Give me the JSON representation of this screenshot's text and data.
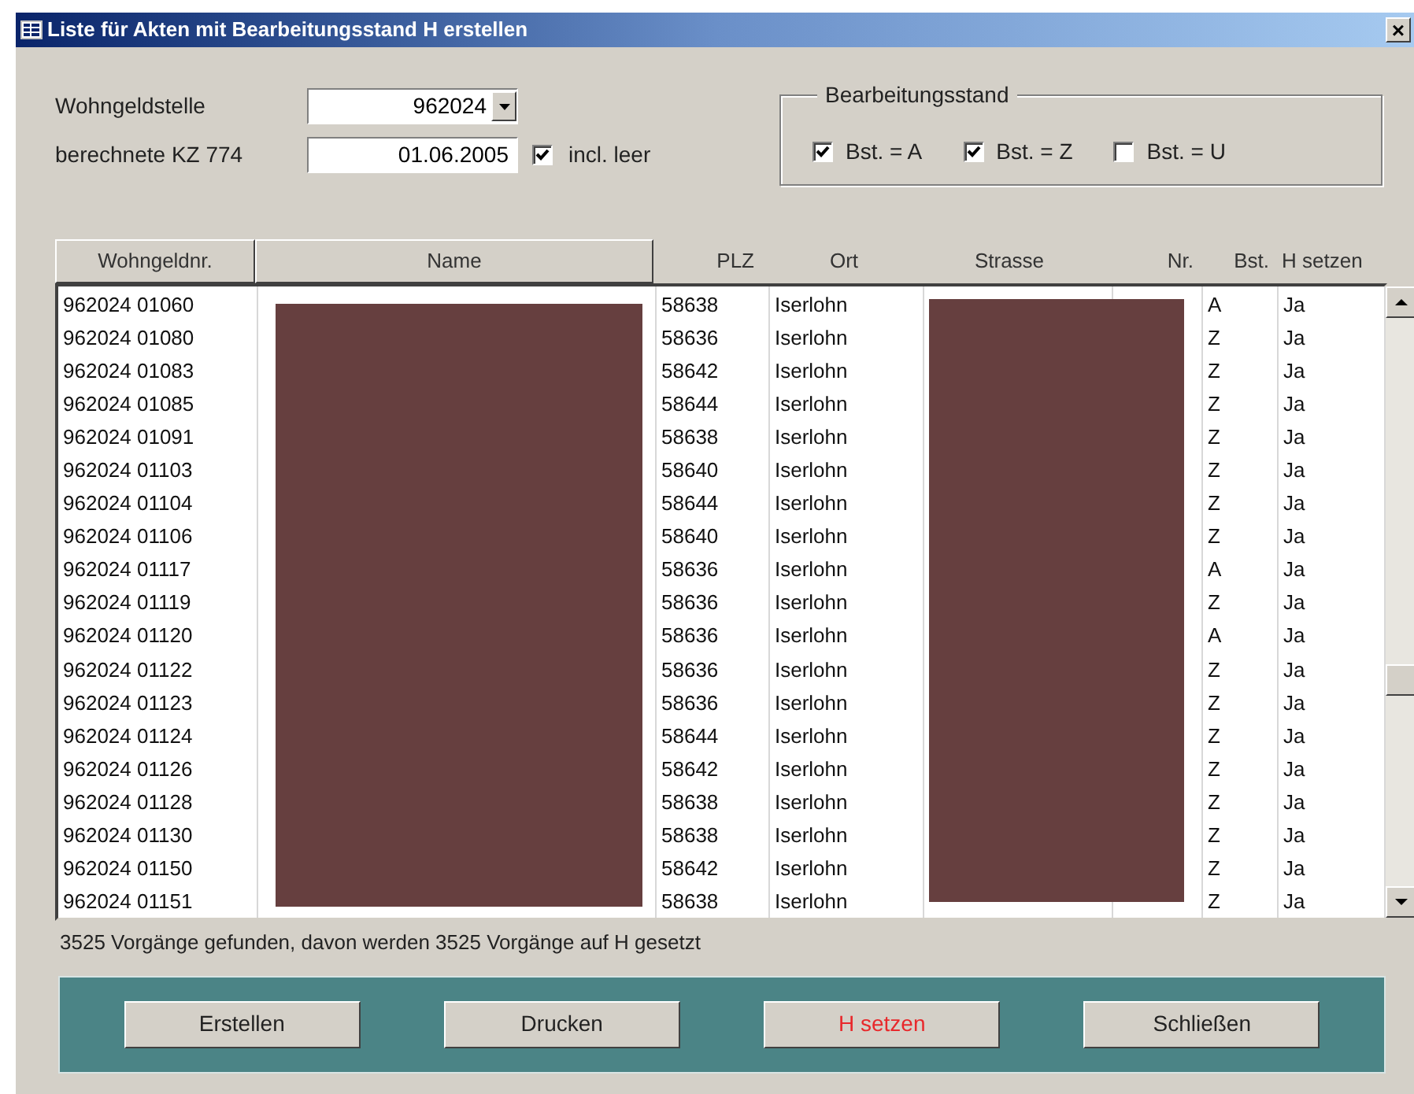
{
  "window": {
    "title": "Liste für Akten mit Bearbeitungsstand H erstellen",
    "close": "×"
  },
  "fields": [
    {
      "label": "Wohngeldstelle",
      "value": "962024",
      "kind": "combo"
    },
    {
      "label": "berechnete KZ 774",
      "value": "01.06.2005",
      "kind": "text",
      "checkbox": {
        "label": "incl. leer",
        "checked": true
      }
    }
  ],
  "bearbeitungsstand": {
    "title": "Bearbeitungsstand",
    "options": [
      {
        "label": "Bst. = A",
        "checked": true
      },
      {
        "label": "Bst. = Z",
        "checked": true
      },
      {
        "label": "Bst. = U",
        "checked": false
      }
    ]
  },
  "table": {
    "columns": [
      "Wohngeldnr.",
      "Name",
      "PLZ",
      "Ort",
      "Strasse",
      "Nr.",
      "Bst.",
      "H setzen"
    ],
    "rows": [
      {
        "wohngeldnr": "962024 01060",
        "plz": "58638",
        "ort": "Iserlohn",
        "bst": "A",
        "h_setzen": "Ja"
      },
      {
        "wohngeldnr": "962024 01080",
        "plz": "58636",
        "ort": "Iserlohn",
        "bst": "Z",
        "h_setzen": "Ja"
      },
      {
        "wohngeldnr": "962024 01083",
        "plz": "58642",
        "ort": "Iserlohn",
        "bst": "Z",
        "h_setzen": "Ja"
      },
      {
        "wohngeldnr": "962024 01085",
        "plz": "58644",
        "ort": "Iserlohn",
        "bst": "Z",
        "h_setzen": "Ja"
      },
      {
        "wohngeldnr": "962024 01091",
        "plz": "58638",
        "ort": "Iserlohn",
        "bst": "Z",
        "h_setzen": "Ja"
      },
      {
        "wohngeldnr": "962024 01103",
        "plz": "58640",
        "ort": "Iserlohn",
        "bst": "Z",
        "h_setzen": "Ja"
      },
      {
        "wohngeldnr": "962024 01104",
        "plz": "58644",
        "ort": "Iserlohn",
        "bst": "Z",
        "h_setzen": "Ja"
      },
      {
        "wohngeldnr": "962024 01106",
        "plz": "58640",
        "ort": "Iserlohn",
        "bst": "Z",
        "h_setzen": "Ja"
      },
      {
        "wohngeldnr": "962024 01117",
        "plz": "58636",
        "ort": "Iserlohn",
        "bst": "A",
        "h_setzen": "Ja"
      },
      {
        "wohngeldnr": "962024 01119",
        "plz": "58636",
        "ort": "Iserlohn",
        "bst": "Z",
        "h_setzen": "Ja"
      },
      {
        "wohngeldnr": "962024 01120",
        "plz": "58636",
        "ort": "Iserlohn",
        "bst": "A",
        "h_setzen": "Ja"
      },
      {
        "wohngeldnr": "962024 01122",
        "plz": "58636",
        "ort": "Iserlohn",
        "bst": "Z",
        "h_setzen": "Ja"
      },
      {
        "wohngeldnr": "962024 01123",
        "plz": "58636",
        "ort": "Iserlohn",
        "bst": "Z",
        "h_setzen": "Ja"
      },
      {
        "wohngeldnr": "962024 01124",
        "plz": "58644",
        "ort": "Iserlohn",
        "bst": "Z",
        "h_setzen": "Ja"
      },
      {
        "wohngeldnr": "962024 01126",
        "plz": "58642",
        "ort": "Iserlohn",
        "bst": "Z",
        "h_setzen": "Ja"
      },
      {
        "wohngeldnr": "962024 01128",
        "plz": "58638",
        "ort": "Iserlohn",
        "bst": "Z",
        "h_setzen": "Ja"
      },
      {
        "wohngeldnr": "962024 01130",
        "plz": "58638",
        "ort": "Iserlohn",
        "bst": "Z",
        "h_setzen": "Ja"
      },
      {
        "wohngeldnr": "962024 01150",
        "plz": "58642",
        "ort": "Iserlohn",
        "bst": "Z",
        "h_setzen": "Ja"
      },
      {
        "wohngeldnr": "962024 01151",
        "plz": "58638",
        "ort": "Iserlohn",
        "bst": "Z",
        "h_setzen": "Ja"
      }
    ]
  },
  "status": "3525 Vorgänge gefunden, davon werden 3525 Vorgänge auf H gesetzt",
  "buttons": [
    {
      "label": "Erstellen",
      "emphasis": false
    },
    {
      "label": "Drucken",
      "emphasis": false
    },
    {
      "label": "H setzen",
      "emphasis": true
    },
    {
      "label": "Schließen",
      "emphasis": false
    }
  ]
}
